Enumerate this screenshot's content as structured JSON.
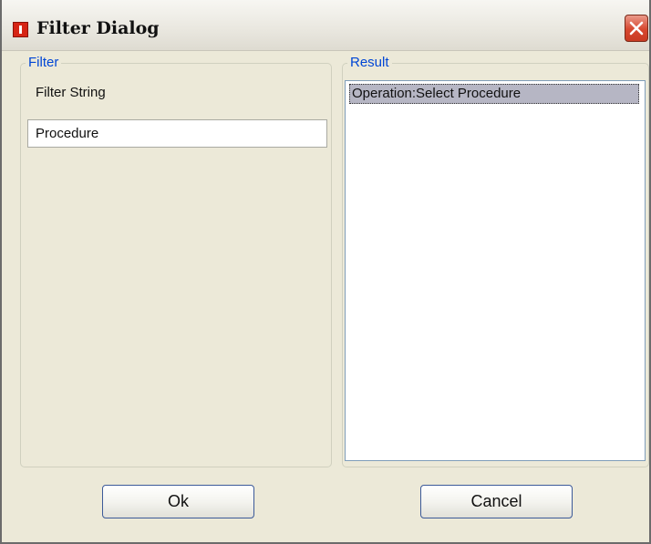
{
  "window": {
    "title": "Filter Dialog",
    "icons": {
      "app": "app-icon",
      "close": "close-icon"
    }
  },
  "filter": {
    "legend": "Filter",
    "label": "Filter String",
    "value": "Procedure"
  },
  "result": {
    "legend": "Result",
    "items": [
      "Operation:Select Procedure"
    ],
    "selected_index": 0
  },
  "buttons": {
    "ok": "Ok",
    "cancel": "Cancel"
  },
  "colors": {
    "dialog_bg": "#ece9d8",
    "legend_text": "#0046d5",
    "close_button": "#d7472f",
    "selected_item": "#b6b6c4"
  }
}
